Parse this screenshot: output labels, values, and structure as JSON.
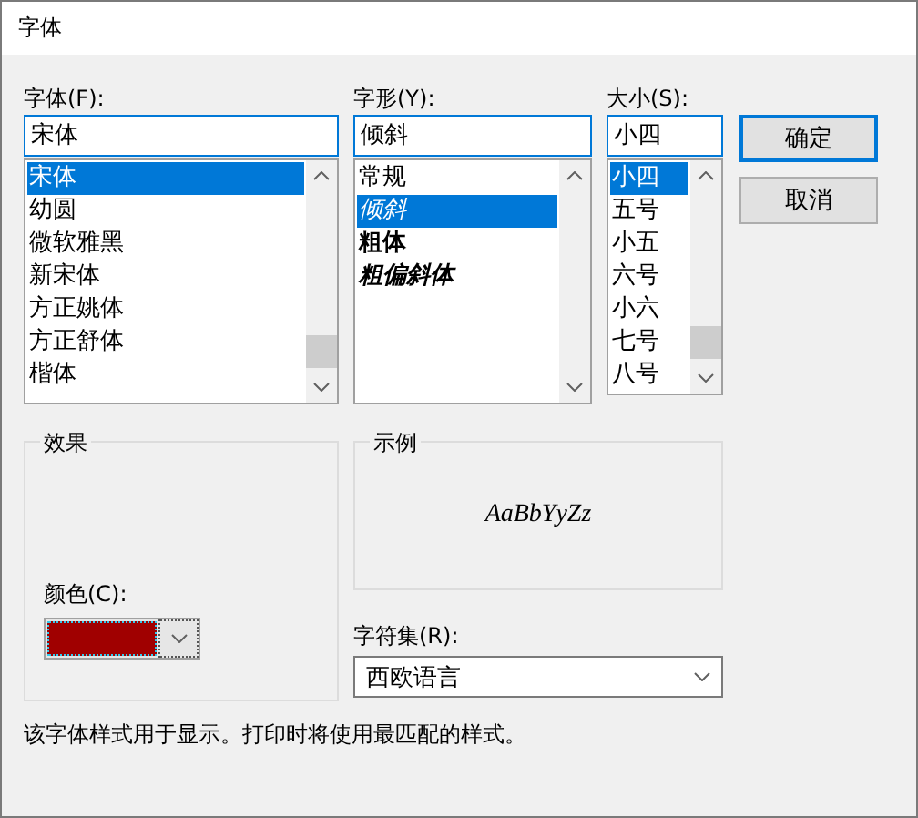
{
  "window": {
    "title": "字体"
  },
  "font": {
    "label": "字体(F):",
    "value": "宋体",
    "items": [
      {
        "label": "宋体",
        "selected": true
      },
      {
        "label": "幼圆",
        "selected": false
      },
      {
        "label": "微软雅黑",
        "selected": false
      },
      {
        "label": "新宋体",
        "selected": false
      },
      {
        "label": "方正姚体",
        "selected": false
      },
      {
        "label": "方正舒体",
        "selected": false
      },
      {
        "label": "楷体",
        "selected": false
      }
    ]
  },
  "style": {
    "label": "字形(Y):",
    "value": "倾斜",
    "items": [
      {
        "label": "常规",
        "kind": "regular",
        "selected": false
      },
      {
        "label": "倾斜",
        "kind": "italic",
        "selected": true
      },
      {
        "label": "粗体",
        "kind": "bold",
        "selected": false
      },
      {
        "label": "粗偏斜体",
        "kind": "bolditalic",
        "selected": false
      }
    ]
  },
  "size": {
    "label": "大小(S):",
    "value": "小四",
    "items": [
      {
        "label": "小四",
        "selected": true
      },
      {
        "label": "五号",
        "selected": false
      },
      {
        "label": "小五",
        "selected": false
      },
      {
        "label": "六号",
        "selected": false
      },
      {
        "label": "小六",
        "selected": false
      },
      {
        "label": "七号",
        "selected": false
      },
      {
        "label": "八号",
        "selected": false
      }
    ]
  },
  "buttons": [
    {
      "label": "确定",
      "default": true
    },
    {
      "label": "取消",
      "default": false
    }
  ],
  "effects": {
    "title": "效果",
    "color_label": "颜色(C):",
    "color": "#a00000"
  },
  "sample": {
    "title": "示例",
    "text": "AaBbYyZz"
  },
  "charset": {
    "label": "字符集(R):",
    "value": "西欧语言"
  },
  "footer": "该字体样式用于显示。打印时将使用最匹配的样式。"
}
